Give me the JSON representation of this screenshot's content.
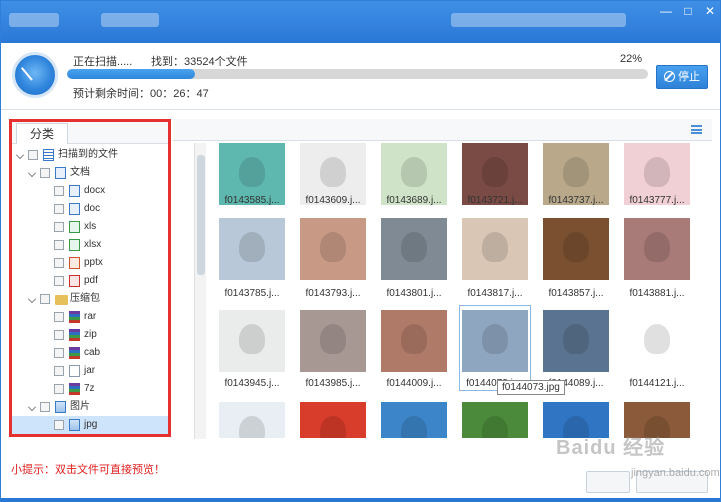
{
  "window": {
    "controls": [
      "—",
      "□",
      "✕"
    ]
  },
  "scan": {
    "status": "正在扫描.....",
    "found": "找到：33524个文件",
    "percent": "22%",
    "progress": 0.22,
    "remaining": "预计剩余时间：00：26：47",
    "stop_label": "停止"
  },
  "tree": {
    "tab_label": "分类",
    "items": [
      {
        "label": "扫描到的文件",
        "level": 0,
        "expanded": true,
        "icon": "list-icon"
      },
      {
        "label": "文档",
        "level": 1,
        "expanded": true,
        "icon": "document-icon"
      },
      {
        "label": "docx",
        "level": 2,
        "icon": "word-icon"
      },
      {
        "label": "doc",
        "level": 2,
        "icon": "word-icon"
      },
      {
        "label": "xls",
        "level": 2,
        "icon": "excel-icon"
      },
      {
        "label": "xlsx",
        "level": 2,
        "icon": "excel-icon"
      },
      {
        "label": "pptx",
        "level": 2,
        "icon": "powerpoint-icon"
      },
      {
        "label": "pdf",
        "level": 2,
        "icon": "pdf-icon"
      },
      {
        "label": "压缩包",
        "level": 1,
        "expanded": true,
        "icon": "folder-icon"
      },
      {
        "label": "rar",
        "level": 2,
        "icon": "archive-icon"
      },
      {
        "label": "zip",
        "level": 2,
        "icon": "archive-icon"
      },
      {
        "label": "cab",
        "level": 2,
        "icon": "archive-icon"
      },
      {
        "label": "jar",
        "level": 2,
        "icon": "file-icon"
      },
      {
        "label": "7z",
        "level": 2,
        "icon": "archive-icon"
      },
      {
        "label": "图片",
        "level": 1,
        "expanded": true,
        "icon": "image-folder-icon"
      },
      {
        "label": "jpg",
        "level": 2,
        "icon": "image-icon",
        "selected": true
      }
    ]
  },
  "grid": {
    "rows": [
      [
        "f0143585.j...",
        "f0143609.j...",
        "f0143689.j...",
        "f0143721.j...",
        "f0143737.j...",
        "f0143777.j..."
      ],
      [
        "f0143785.j...",
        "f0143793.j...",
        "f0143801.j...",
        "f0143817.j...",
        "f0143857.j...",
        "f0143881.j..."
      ],
      [
        "f0143945.j...",
        "f0143985.j...",
        "f0144009.j...",
        "f0144073.jpg",
        "f0144089.j...",
        "f0144121.j..."
      ],
      [
        "",
        "",
        "",
        "",
        "",
        ""
      ]
    ],
    "tooltip": "f0144073.jpg",
    "colors": [
      [
        "#5fb8b0",
        "#ededed",
        "#cfe3c8",
        "#7a4a45",
        "#b9a98a",
        "#f0cfd5"
      ],
      [
        "#b8c8d8",
        "#c89a85",
        "#7f8a95",
        "#d9c6b5",
        "#7a5030",
        "#a87a78"
      ],
      [
        "#e9eceb",
        "#a89893",
        "#b07a68",
        "#8fa6c0",
        "#5a7390",
        "#ffffff"
      ],
      [
        "#e8eef3",
        "#d83c2a",
        "#3c85c8",
        "#4a8a3a",
        "#2f75c4",
        "#8a5a3a"
      ]
    ]
  },
  "footer": {
    "tip": "小提示：双击文件可直接预览！",
    "watermark": "Baidu 经验",
    "watermark_sub": "jingyan.baidu.com"
  }
}
